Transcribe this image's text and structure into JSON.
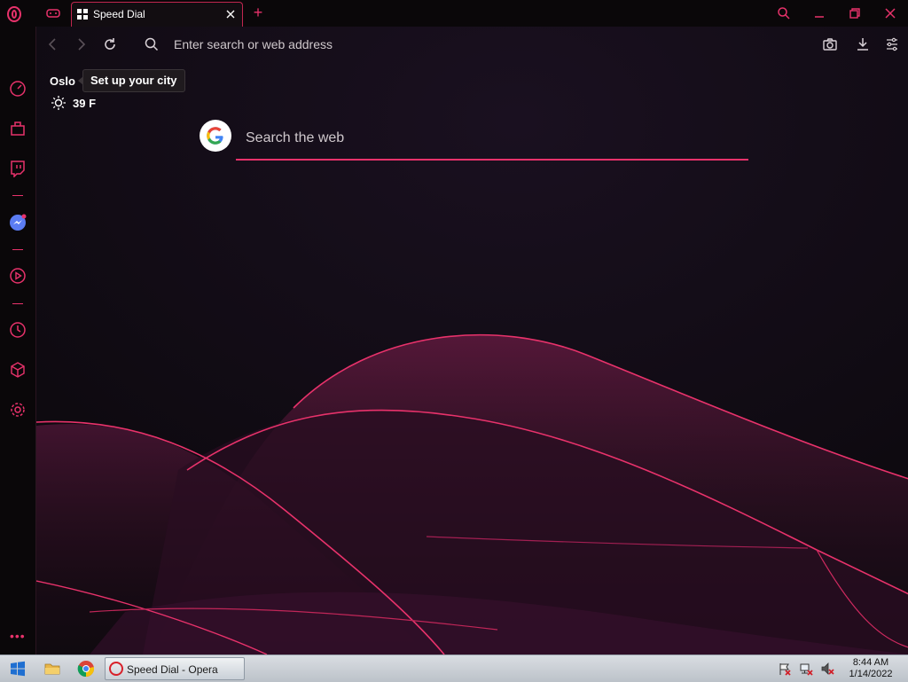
{
  "titlebar": {
    "tab": {
      "title": "Speed Dial"
    }
  },
  "addressbar": {
    "placeholder": "Enter search or web address"
  },
  "weather": {
    "city": "Oslo",
    "tooltip": "Set up your city",
    "temperature": "39 F"
  },
  "search": {
    "placeholder": "Search the web"
  },
  "taskbar": {
    "app_label": "Speed Dial - Opera",
    "time": "8:44 AM",
    "date": "1/14/2022"
  },
  "colors": {
    "accent": "#e8326b",
    "background": "#120b12",
    "sidebar": "#0a0709"
  }
}
